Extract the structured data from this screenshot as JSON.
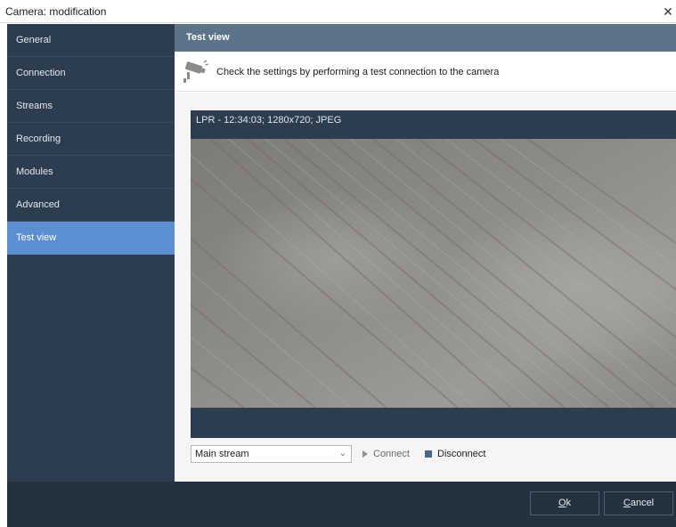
{
  "window": {
    "title": "Camera: modification",
    "close_glyph": "✕"
  },
  "sidebar": {
    "items": [
      {
        "label": "General",
        "active": false
      },
      {
        "label": "Connection",
        "active": false
      },
      {
        "label": "Streams",
        "active": false
      },
      {
        "label": "Recording",
        "active": false
      },
      {
        "label": "Modules",
        "active": false
      },
      {
        "label": "Advanced",
        "active": false
      },
      {
        "label": "Test view",
        "active": true
      }
    ]
  },
  "main": {
    "section_title": "Test view",
    "info_icon": "camera-icon",
    "info_text": "Check the settings by performing a test connection to the camera",
    "video": {
      "caption": "LPR - 12:34:03; 1280x720; JPEG"
    },
    "stream_select": {
      "value": "Main stream"
    },
    "connect_label": "Connect",
    "disconnect_label": "Disconnect"
  },
  "footer": {
    "ok_accel": "O",
    "ok_rest": "k",
    "cancel_accel": "C",
    "cancel_rest": "ancel"
  },
  "colors": {
    "sidebar_bg": "#2c3d50",
    "active_item": "#5b8fd1",
    "header_bar": "#5d7389",
    "footer_bg": "#24313f",
    "disconnect_square": "#4a6688"
  }
}
